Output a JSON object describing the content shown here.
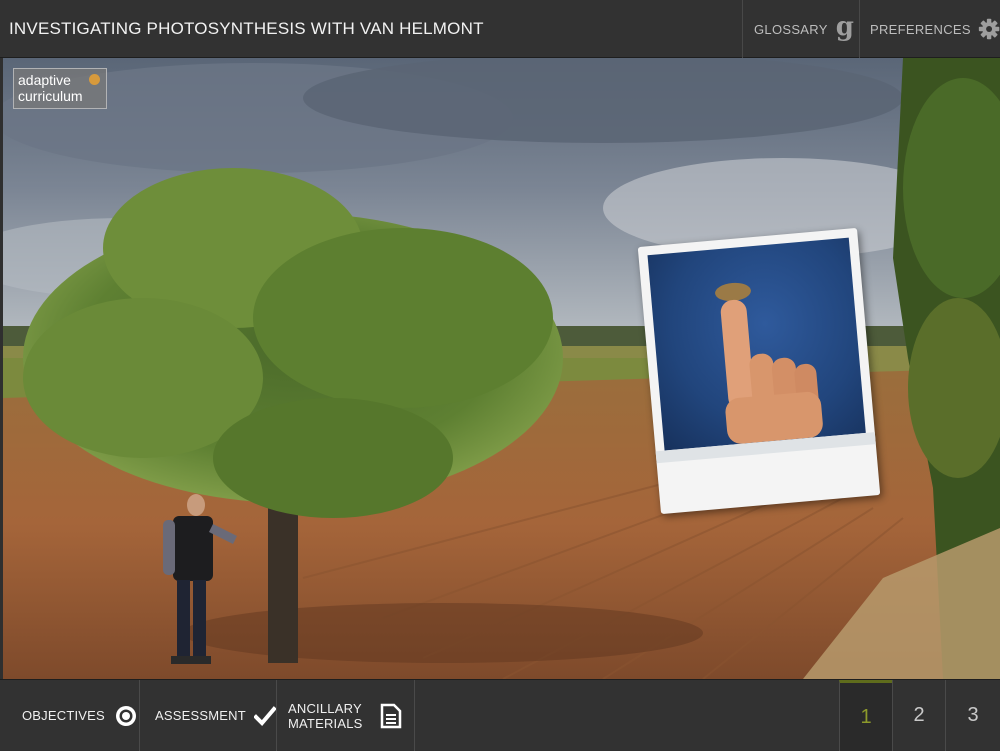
{
  "header": {
    "title": "INVESTIGATING PHOTOSYNTHESIS WITH VAN HELMONT",
    "glossary_label": "GLOSSARY",
    "preferences_label": "PREFERENCES"
  },
  "logo": {
    "line1": "adaptive",
    "line2": "curriculum"
  },
  "footer": {
    "objectives_label": "OBJECTIVES",
    "assessment_label": "ASSESSMENT",
    "ancillary_label_1": "ANCILLARY",
    "ancillary_label_2": "MATERIALS",
    "pages": [
      "1",
      "2",
      "3"
    ],
    "active_page": "1"
  },
  "colors": {
    "bar": "#323232",
    "active_page": "#8d9a2b",
    "text": "#f0f0f0"
  }
}
